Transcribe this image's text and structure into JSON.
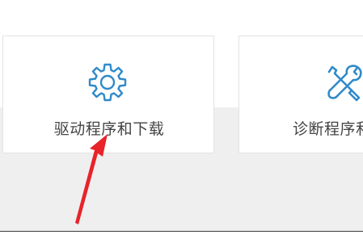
{
  "cards": [
    {
      "label": "驱动程序和下载",
      "icon": "gear-icon"
    },
    {
      "label": "诊断程序和",
      "icon": "tools-icon"
    }
  ],
  "colors": {
    "icon_blue": "#2f8ac9",
    "label_text": "#444444",
    "arrow_red": "#e8232a",
    "background_gray": "#efefef",
    "card_border": "#e3e3e3"
  }
}
